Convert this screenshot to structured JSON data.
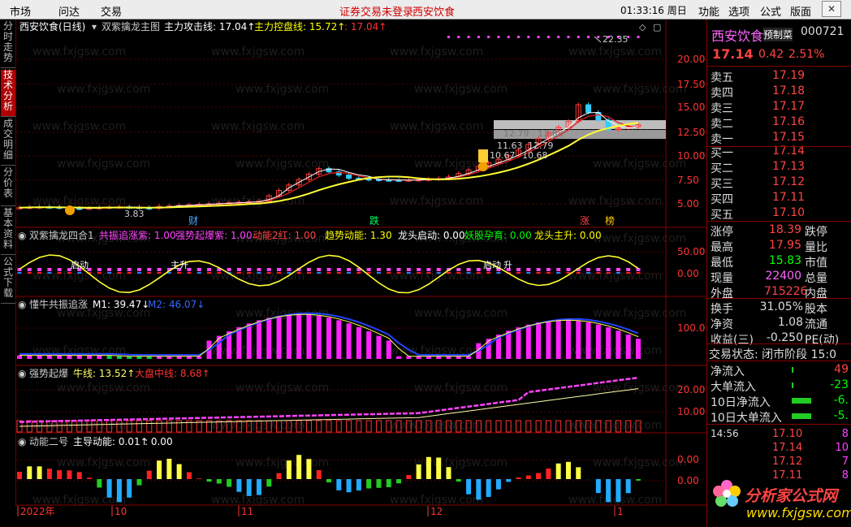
{
  "menu": {
    "items": [
      "市场",
      "问达",
      "交易"
    ],
    "notice": "证券交易未登录",
    "stock_short": "西安饮食",
    "clock": "01:33:16 周日",
    "right_items": [
      "功能",
      "选项",
      "公式",
      "版面"
    ]
  },
  "left_tabs": [
    "分时走势",
    "技术分析",
    "成交明细",
    "分价表",
    "基本资料",
    "公式下载"
  ],
  "panel1": {
    "title": "西安饮食(日线)",
    "indicator": "双紫擒龙主图",
    "labels": [
      {
        "t": "主力攻击线: 17.04↑",
        "c": "#ffffff"
      },
      {
        "t": "主力控盘线: 15.72↑",
        "c": "#ffff00"
      },
      {
        "t": ": 17.04↑",
        "c": "#ff3333"
      }
    ],
    "yticks": [
      {
        "v": "20.00",
        "y": 73
      },
      {
        "v": "17.50",
        "y": 104
      },
      {
        "v": "15.00",
        "y": 132
      },
      {
        "v": "12.50",
        "y": 163
      },
      {
        "v": "10.00",
        "y": 192
      },
      {
        "v": "7.50",
        "y": 222
      },
      {
        "v": "5.00",
        "y": 251
      }
    ],
    "annotations": [
      {
        "t": "22.35",
        "x": 742,
        "y": 52,
        "c": "#cccccc"
      },
      {
        "t": "12.79",
        "x": 620,
        "y": 168,
        "c": "#777777"
      },
      {
        "t": "13.68",
        "x": 662,
        "y": 168,
        "c": "#777777"
      },
      {
        "t": "11.63",
        "x": 612,
        "y": 183,
        "c": "#cccccc"
      },
      {
        "t": "12.79",
        "x": 650,
        "y": 183,
        "c": "#cccccc"
      },
      {
        "t": "10.67",
        "x": 603,
        "y": 195,
        "c": "#cccccc"
      },
      {
        "t": "10.68",
        "x": 643,
        "y": 195,
        "c": "#cccccc"
      },
      {
        "t": "3.83",
        "x": 153,
        "y": 267,
        "c": "#cccccc"
      }
    ],
    "tags": [
      {
        "t": "财",
        "x": 232,
        "c": "#44aaff"
      },
      {
        "t": "跌",
        "x": 455,
        "c": "#00ff66"
      },
      {
        "t": "涨",
        "x": 714,
        "c": "#ff4444"
      },
      {
        "t": "榜",
        "x": 745,
        "c": "#ffcc00"
      }
    ]
  },
  "panel2": {
    "indicator": "双紫擒龙四合1",
    "labels": [
      {
        "t": "共振追涨紫: 1.00",
        "c": "#ff44ff"
      },
      {
        "t": "强势起爆紫: 1.00",
        "c": "#ff44ff"
      },
      {
        "t": "动能2红: 1.00",
        "c": "#ff4444"
      },
      {
        "t": "趋势动能: 1.30",
        "c": "#ffff00"
      },
      {
        "t": "龙头启动: 0.00",
        "c": "#ffffff"
      },
      {
        "t": "妖股孕育: 0.00",
        "c": "#00ff00"
      },
      {
        "t": "龙头主升: 0.00",
        "c": "#ffff00"
      }
    ],
    "yticks": [
      {
        "v": "50.00",
        "y": 310
      },
      {
        "v": "0.00",
        "y": 337
      }
    ],
    "marks": [
      {
        "t": "启动",
        "x": 87
      },
      {
        "t": "主升",
        "x": 210
      },
      {
        "t": "启动",
        "x": 595
      },
      {
        "t": "升",
        "x": 620
      }
    ]
  },
  "panel3": {
    "indicator": "懂牛共振追涨",
    "m1": "M1: 39.47↓",
    "m2": "M2: 46.07↓",
    "yticks": [
      {
        "v": "100.0",
        "y": 404
      }
    ]
  },
  "panel4": {
    "indicator": "强势起爆",
    "l1": "牛线: 13.52↑",
    "l2": "大盘中线: 8.68↑",
    "yticks": [
      {
        "v": "20.00",
        "y": 480
      },
      {
        "v": "10.00",
        "y": 507
      }
    ]
  },
  "panel5": {
    "indicator": "动能二号",
    "l1": "主导动能: 0.01↑",
    "l2": ": 0.00",
    "yticks": [
      {
        "v": "0.00",
        "y": 566
      },
      {
        "v": "0.00",
        "y": 592
      }
    ]
  },
  "xaxis": [
    {
      "t": "2022年",
      "x": 22
    },
    {
      "t": "10",
      "x": 138
    },
    {
      "t": "11",
      "x": 294
    },
    {
      "t": "12",
      "x": 527
    },
    {
      "t": "1",
      "x": 757
    }
  ],
  "quote": {
    "name": "西安饮食",
    "tag": "预制菜",
    "code": "000721",
    "price": "17.14",
    "change": "0.42",
    "pct": "2.51%"
  },
  "asks": [
    {
      "l": "卖五",
      "p": "17.19",
      "v": ""
    },
    {
      "l": "卖四",
      "p": "17.18",
      "v": ""
    },
    {
      "l": "卖三",
      "p": "17.17",
      "v": ""
    },
    {
      "l": "卖二",
      "p": "17.16",
      "v": ""
    },
    {
      "l": "卖一",
      "p": "17.15",
      "v": ""
    }
  ],
  "bids": [
    {
      "l": "买一",
      "p": "17.14",
      "v": ""
    },
    {
      "l": "买二",
      "p": "17.13",
      "v": ""
    },
    {
      "l": "买三",
      "p": "17.12",
      "v": ""
    },
    {
      "l": "买四",
      "p": "17.11",
      "v": ""
    },
    {
      "l": "买五",
      "p": "17.10",
      "v": ""
    }
  ],
  "stats": [
    {
      "l": "涨停",
      "v": "18.39",
      "c": "#ff4444",
      "l2": "跌停"
    },
    {
      "l": "最高",
      "v": "17.95",
      "c": "#ff4444",
      "l2": "量比"
    },
    {
      "l": "最低",
      "v": "15.83",
      "c": "#00ff00",
      "l2": "市值"
    },
    {
      "l": "现量",
      "v": "22400",
      "c": "#ff66ff",
      "l2": "总量"
    },
    {
      "l": "外盘",
      "v": "715226",
      "c": "#ff4444",
      "l2": "内盘"
    }
  ],
  "stats2": [
    {
      "l": "换手",
      "v": "31.05%",
      "l2": "股本"
    },
    {
      "l": "净资",
      "v": "1.08",
      "l2": "流通"
    },
    {
      "l": "收益(三)",
      "v": "-0.250",
      "l2": "PE(动)"
    }
  ],
  "status": "交易状态: 闭市阶段 15:0",
  "flows": [
    {
      "l": "净流入",
      "v": "49",
      "c": "#ff4444",
      "bar": false
    },
    {
      "l": "大单流入",
      "v": "-23",
      "c": "#00ff00",
      "bar": false
    },
    {
      "l": "10日净流入",
      "v": "-6.",
      "c": "#00ff00",
      "bar": true
    },
    {
      "l": "10日大单流入",
      "v": "-5.",
      "c": "#00ff00",
      "bar": true
    }
  ],
  "ticks": [
    {
      "t": "14:56",
      "p": "17.10",
      "v": "8"
    },
    {
      "t": "",
      "p": "17.14",
      "v": "10"
    },
    {
      "t": "",
      "p": "17.12",
      "v": "7"
    },
    {
      "t": "",
      "p": "17.11",
      "v": "8"
    }
  ],
  "watermark": "分析家公式网",
  "watermark_url": "www.fxjgsw.com"
}
